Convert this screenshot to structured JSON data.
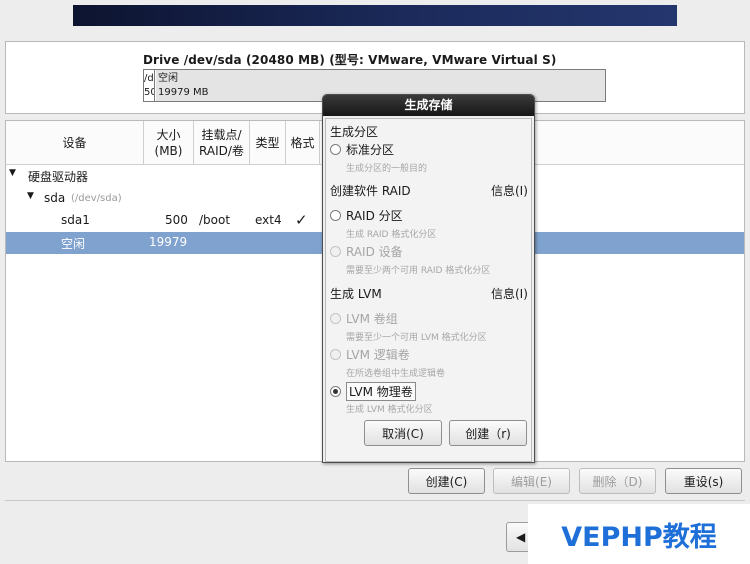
{
  "drive": {
    "title": "Drive /dev/sda (20480 MB) (型号: VMware, VMware Virtual S)",
    "segment1_line1": "/d",
    "segment1_line2": "50",
    "segment2_line1": "空闲",
    "segment2_line2": "19979 MB"
  },
  "table": {
    "headers": {
      "device": "设备",
      "size": "大小\n(MB)",
      "mount": "挂载点/\nRAID/卷",
      "type": "类型",
      "format": "格式"
    },
    "hard_drives_label": "硬盘驱动器",
    "disk_name": "sda",
    "disk_path": "(/dev/sda)",
    "rows": [
      {
        "device": "sda1",
        "size": "500",
        "mount": "/boot",
        "type": "ext4",
        "format": "✓"
      },
      {
        "device": "空闲",
        "size": "19979",
        "mount": "",
        "type": "",
        "format": ""
      }
    ]
  },
  "buttons": {
    "create": "创建(C)",
    "edit": "编辑(E)",
    "delete": "删除（D)",
    "reset": "重设(s)",
    "back_glyph": "◀"
  },
  "dialog": {
    "title": "生成存储",
    "section_partition": "生成分区",
    "standard_partition": "标准分区",
    "standard_partition_hint": "生成分区的一般目的",
    "section_raid": "创建软件 RAID",
    "raid_info": "信息(I)",
    "raid_partition": "RAID 分区",
    "raid_partition_hint": "生成 RAID 格式化分区",
    "raid_device": "RAID 设备",
    "raid_device_hint": "需要至少两个可用 RAID 格式化分区",
    "section_lvm": "生成 LVM",
    "lvm_info": "信息(I)",
    "lvm_vg": "LVM 卷组",
    "lvm_vg_hint": "需要至少一个可用 LVM 格式化分区",
    "lvm_lv": "LVM 逻辑卷",
    "lvm_lv_hint": "在所选卷组中生成逻辑卷",
    "lvm_pv": "LVM 物理卷",
    "lvm_pv_hint": "生成 LVM 格式化分区",
    "cancel": "取消(C)",
    "create": "创建（r)"
  },
  "watermark": "VEPHP教程"
}
